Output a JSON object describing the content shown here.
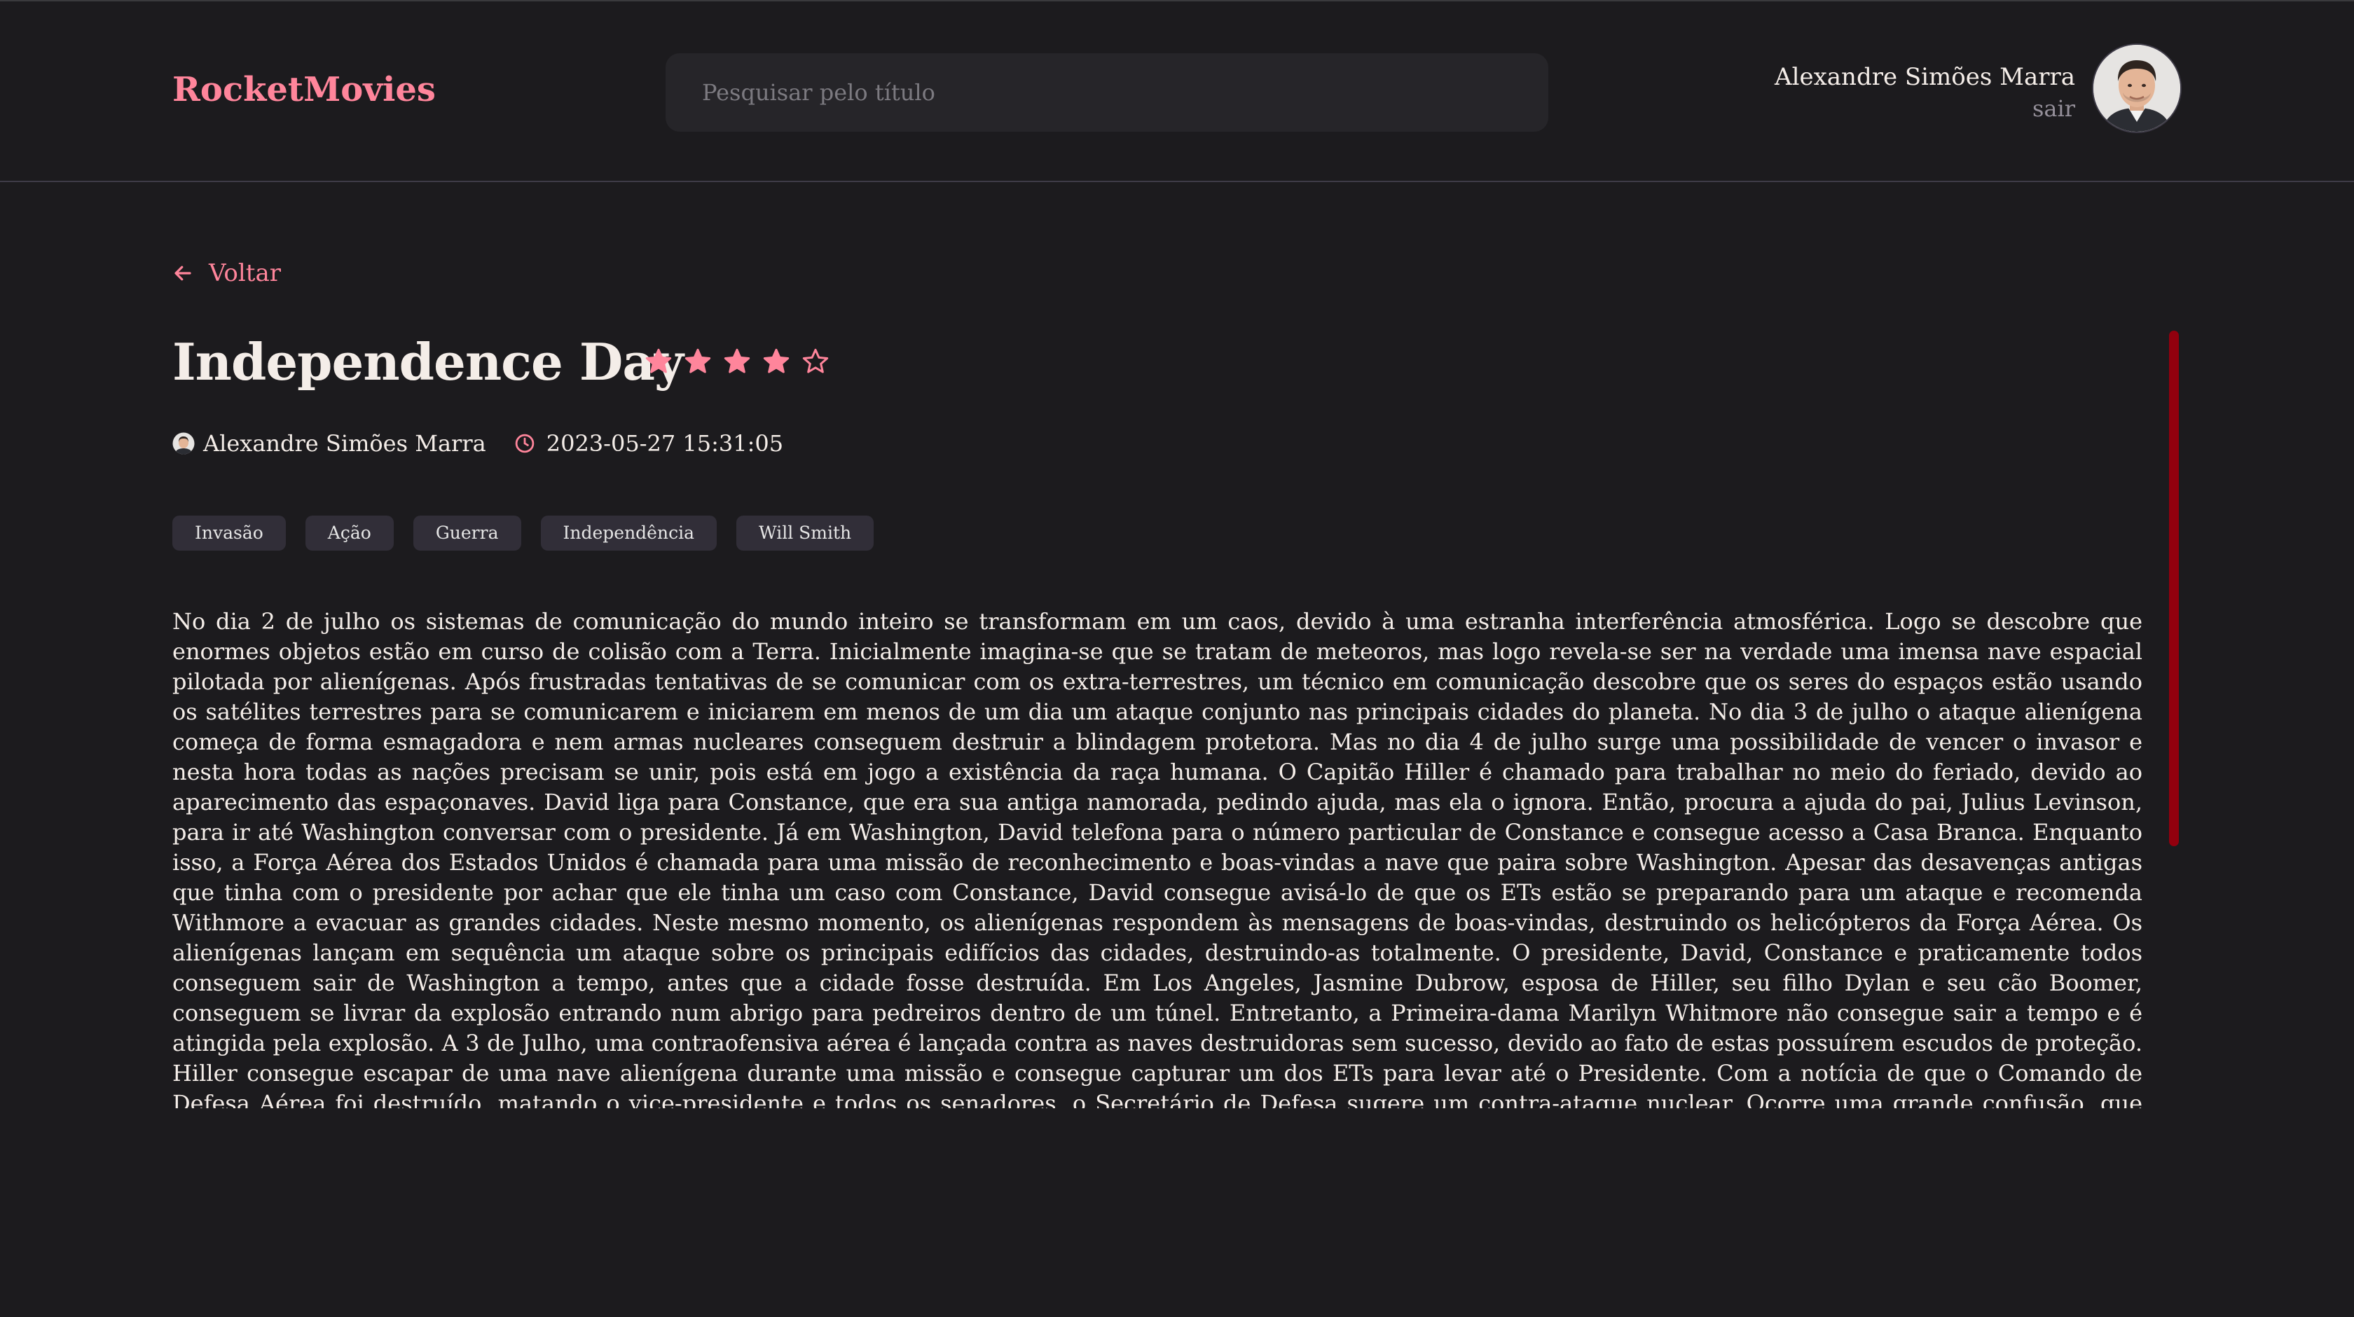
{
  "header": {
    "logo": "RocketMovies",
    "search": {
      "placeholder": "Pesquisar pelo título",
      "value": ""
    },
    "profile": {
      "name": "Alexandre Simões Marra",
      "logout": "sair"
    }
  },
  "nav": {
    "back_label": "Voltar",
    "back_icon": "arrow-left-icon"
  },
  "movie": {
    "title": "Independence Day",
    "rating": 4,
    "rating_max": 5,
    "author": "Alexandre Simões Marra",
    "created_at": "2023-05-27 15:31:05",
    "tags": [
      "Invasão",
      "Ação",
      "Guerra",
      "Independência",
      "Will Smith"
    ],
    "description": "No dia 2 de julho os sistemas de comunicação do mundo inteiro se transformam em um caos, devido à uma estranha interferência atmosférica. Logo se descobre que enormes objetos estão em curso de colisão com a Terra. Inicialmente imagina-se que se tratam de meteoros, mas logo revela-se ser na verdade uma imensa nave espacial pilotada por alienígenas. Após frustradas tentativas de se comunicar com os extra-terrestres, um técnico em comunicação descobre que os seres do espaços estão usando os satélites terrestres para se comunicarem e iniciarem em menos de um dia um ataque conjunto nas principais cidades do planeta. No dia 3 de julho o ataque alienígena começa de forma esmagadora e nem armas nucleares conseguem destruir a blindagem protetora. Mas no dia 4 de julho surge uma possibilidade de vencer o invasor e nesta hora todas as nações precisam se unir, pois está em jogo a existência da raça humana. O Capitão Hiller é chamado para trabalhar no meio do feriado, devido ao aparecimento das espaçonaves. David liga para Constance, que era sua antiga namorada, pedindo ajuda, mas ela o ignora. Então, procura a ajuda do pai, Julius Levinson, para ir até Washington conversar com o presidente. Já em Washington, David telefona para o número particular de Constance e consegue acesso a Casa Branca. Enquanto isso, a Força Aérea dos Estados Unidos é chamada para uma missão de reconhecimento e boas-vindas a nave que paira sobre Washington. Apesar das desavenças antigas que tinha com o presidente por achar que ele tinha um caso com Constance, David consegue avisá-lo de que os ETs estão se preparando para um ataque e recomenda Withmore a evacuar as grandes cidades. Neste mesmo momento, os alienígenas respondem às mensagens de boas-vindas, destruindo os helicópteros da Força Aérea. Os alienígenas lançam em sequência um ataque sobre os principais edifícios das cidades, destruindo-as totalmente. O presidente, David, Constance e praticamente todos conseguem sair de Washington a tempo, antes que a cidade fosse destruída. Em Los Angeles, Jasmine Dubrow, esposa de Hiller, seu filho Dylan e seu cão Boomer, conseguem se livrar da explosão entrando num abrigo para pedreiros dentro de um túnel. Entretanto, a Primeira-dama Marilyn Whitmore não consegue sair a tempo e é atingida pela explosão. A 3 de Julho, uma contraofensiva aérea é lançada contra as naves destruidoras sem sucesso, devido ao fato de estas possuírem escudos de proteção. Hiller consegue escapar de uma nave alienígena durante uma missão e consegue capturar um dos ETs para levar até o Presidente. Com a notícia de que o Comando de Defesa Aérea foi destruído, matando o vice-presidente e todos os senadores, o Secretário de Defesa sugere um contra-ataque nuclear. Ocorre uma grande confusão, que culmina com a descoberta que a nave que caiu em Roswell em 1947 era, na verdade, um Caça alienígena do mesmo exército dos invasores. Então, todos são levados à Área 51, a base militar mais secreta do planeta. O alienígena capturado por Hiller é levado para estudos na mesma"
  },
  "colors": {
    "background": "#1c1b1e",
    "accent": "#ff859b",
    "text": "#f4ede8",
    "muted": "#948f99",
    "tag_bg": "#312e38",
    "input_bg": "#262529",
    "scrollbar": "#92000e"
  }
}
